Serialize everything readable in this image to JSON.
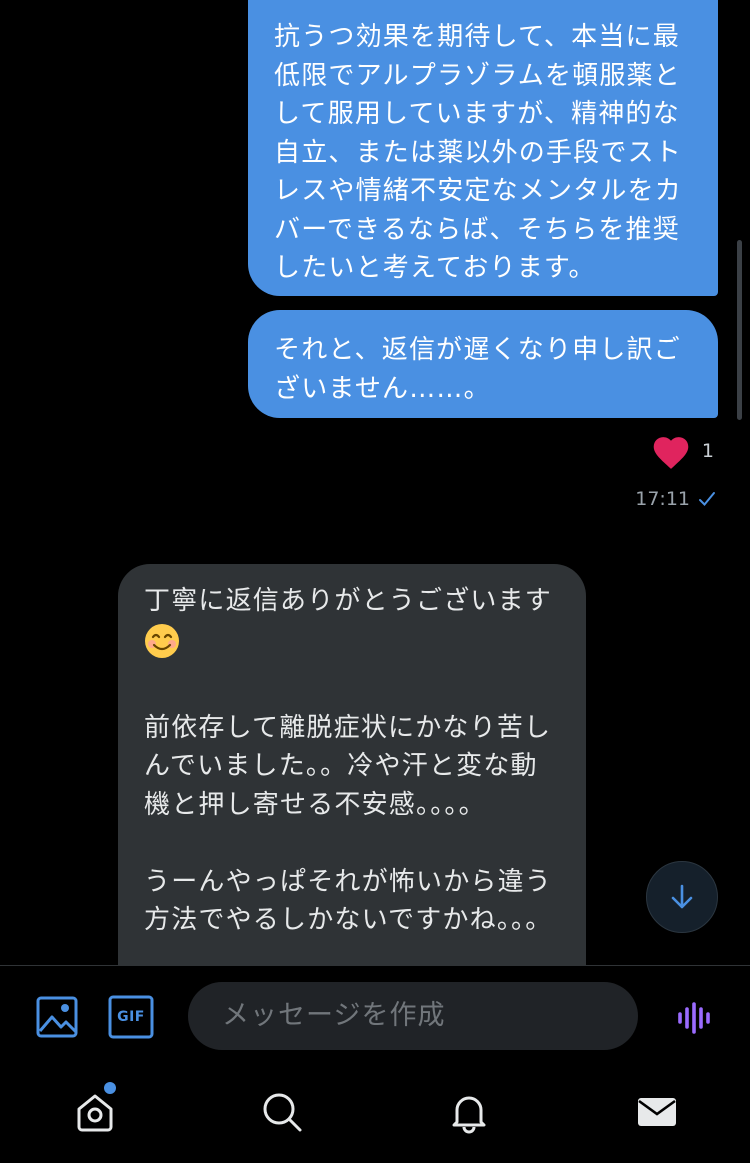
{
  "messages": {
    "outgoing": [
      "抗うつ効果を期待して、本当に最低限でアルプラゾラムを頓服薬として服用していますが、精神的な自立、または薬以外の手段でストレスや情緒不安定なメンタルをカバーできるならば、そちらを推奨したいと考えております。",
      "それと、返信が遅くなり申し訳ございません……。"
    ],
    "reaction": {
      "icon": "heart-icon",
      "count": "1"
    },
    "timestamp": "17:11",
    "incoming": {
      "line1": "丁寧に返信ありがとうございます",
      "emoji": "smiling-face-icon",
      "body": "前依存して離脱症状にかなり苦しんでいました。。冷や汗と変な動機と押し寄せる不安感。。。。\n\nうーんやっぱそれが怖いから違う方法でやるしかないですかね。。。"
    }
  },
  "composer": {
    "placeholder": "メッセージを作成",
    "gif_label": "GIF"
  },
  "tabbar": {
    "items": [
      "home",
      "search",
      "notifications",
      "messages"
    ]
  },
  "colors": {
    "accent": "#4a90e2",
    "incoming_bubble": "#2f3336",
    "heart": "#e0245e",
    "voice": "#9b6bff"
  }
}
